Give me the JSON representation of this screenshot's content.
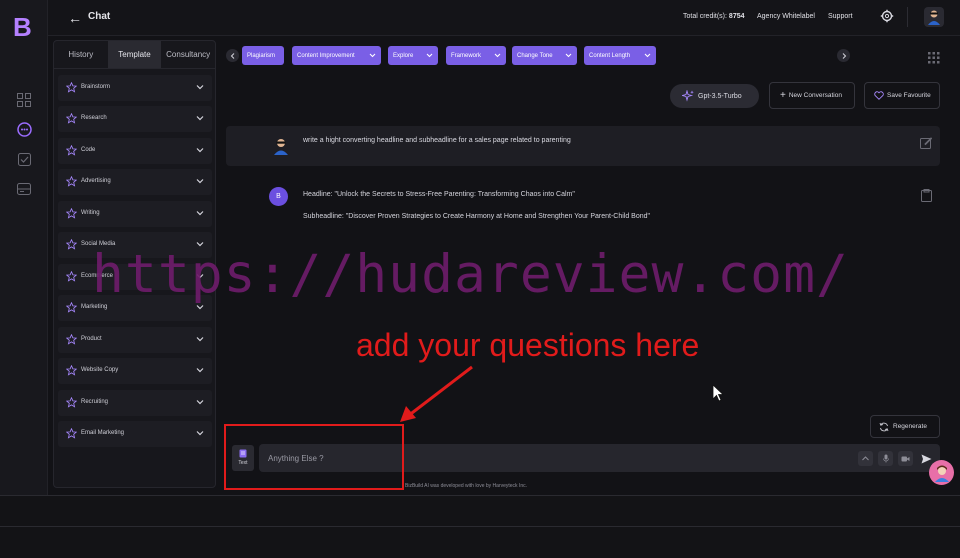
{
  "app": {
    "logo_letter": "B",
    "back_arrow": "←",
    "page_title": "Chat"
  },
  "header": {
    "credits_label": "Total credit(s):",
    "credits_value": "8754",
    "agency_link": "Agency Whitelabel",
    "support_link": "Support"
  },
  "sidebar": {
    "tabs": [
      {
        "label": "History"
      },
      {
        "label": "Template",
        "active": true
      },
      {
        "label": "Consultancy"
      }
    ],
    "templates": [
      {
        "label": "Brainstorm"
      },
      {
        "label": "Research"
      },
      {
        "label": "Code"
      },
      {
        "label": "Advertising"
      },
      {
        "label": "Writing"
      },
      {
        "label": "Social Media"
      },
      {
        "label": "Ecommerce"
      },
      {
        "label": "Marketing"
      },
      {
        "label": "Product"
      },
      {
        "label": "Website Copy"
      },
      {
        "label": "Recruiting"
      },
      {
        "label": "Email Marketing"
      }
    ]
  },
  "toolbar": {
    "chips": [
      {
        "label": "Plagiarism"
      },
      {
        "label": "Content Improvement"
      },
      {
        "label": "Explore"
      },
      {
        "label": "Framework"
      },
      {
        "label": "Change Tone"
      },
      {
        "label": "Content Length"
      }
    ],
    "model_label": "Gpt-3.5-Turbo",
    "new_conversation": "New Conversation",
    "save_favourite": "Save Favourite"
  },
  "conversation": {
    "user_message": "write a hight converting headline and subheadline for a sales page related to parenting",
    "bot_avatar": "B",
    "bot_lines": [
      "Headline: \"Unlock the Secrets to Stress-Free Parenting: Transforming Chaos into Calm\"",
      "Subheadline: \"Discover Proven Strategies to Create Harmony at Home and Strengthen Your Parent-Child Bond\""
    ]
  },
  "overlay": {
    "watermark": "https://hudareview.com/",
    "annotation": "add your questions here"
  },
  "composer": {
    "regenerate": "Regenerate",
    "text_mode_label": "Text",
    "placeholder": "Anything Else ?",
    "footer": "BizBuild AI was developed with love by Harveyteck Inc."
  },
  "colors": {
    "accent": "#7a5fe6",
    "annotation_red": "#e11b1b",
    "watermark_purple": "#6d1c6a"
  }
}
